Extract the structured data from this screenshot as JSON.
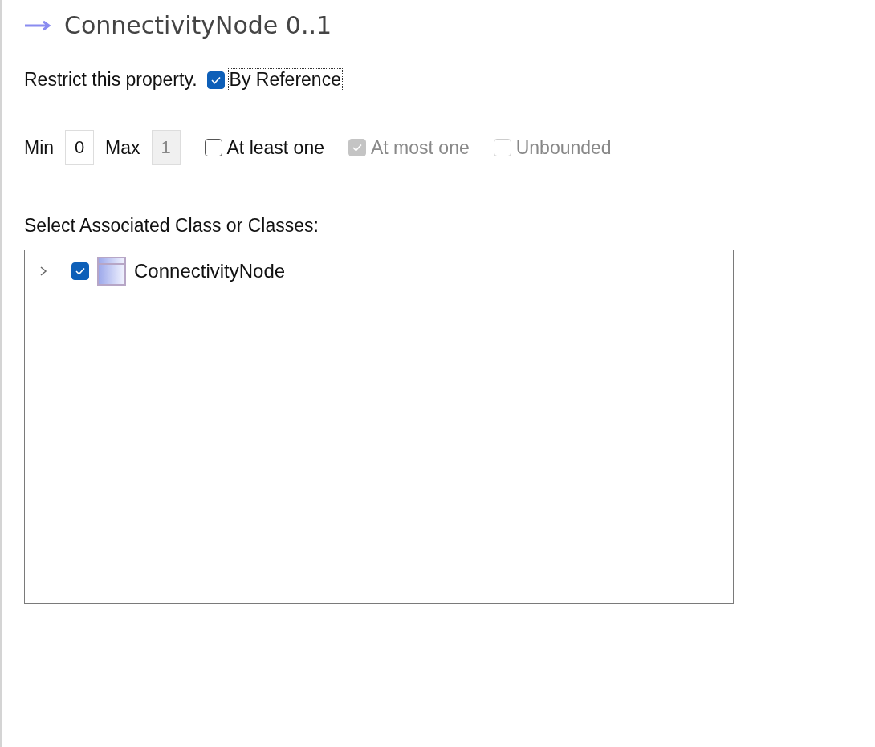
{
  "title": "ConnectivityNode 0..1",
  "restrict": {
    "label": "Restrict this property.",
    "by_reference": {
      "label": "By Reference",
      "checked": true
    }
  },
  "multiplicity": {
    "min_label": "Min",
    "min": "0",
    "max_label": "Max",
    "max": "1",
    "max_disabled": true,
    "options": [
      {
        "label": "At least one",
        "checked": false,
        "disabled": false
      },
      {
        "label": "At most one",
        "checked": true,
        "disabled": true
      },
      {
        "label": "Unbounded",
        "checked": false,
        "disabled": true
      }
    ]
  },
  "classes": {
    "label": "Select Associated Class or Classes:",
    "items": [
      {
        "label": "ConnectivityNode",
        "checked": true,
        "expanded": false
      }
    ]
  }
}
